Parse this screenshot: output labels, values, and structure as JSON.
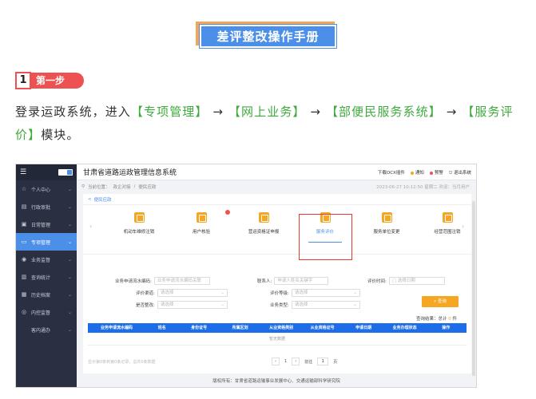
{
  "manual": {
    "title": "差评整改操作手册",
    "step_num": "1",
    "step_label": "第一步",
    "para_prefix": "登录运政系统，进入",
    "path": [
      "【专项管理】",
      "【网上业务】",
      "【部便民服务系统】",
      "【服务评价】"
    ],
    "arrow": " → ",
    "para_suffix": "模块。"
  },
  "app": {
    "sidebar": {
      "items": [
        {
          "label": "个人中心",
          "icon": "☆"
        },
        {
          "label": "行政审批",
          "icon": "▤"
        },
        {
          "label": "日常管理",
          "icon": "▣"
        },
        {
          "label": "专项管理",
          "icon": "▭"
        },
        {
          "label": "业务监督",
          "icon": "◉"
        },
        {
          "label": "查询统计",
          "icon": "▥"
        },
        {
          "label": "历史档案",
          "icon": "▦"
        },
        {
          "label": "内控监督",
          "icon": "◎"
        },
        {
          "label": "客内通办",
          "icon": ""
        }
      ]
    },
    "header": {
      "title": "甘肃省道路运政管理信息系统",
      "download": "下载OCX插件",
      "notice": "通知",
      "warning": "预警",
      "logout": "退出系统"
    },
    "breadcrumb": {
      "home": "当前位置：",
      "p1": "政企对接",
      "sep": "/",
      "p2": "便民应政",
      "info": "2023-06-27 10:12:50 星期二 欢迎：当月用户"
    },
    "panel_tab": "便民应政",
    "modules": [
      {
        "label": "机动车维修注销"
      },
      {
        "label": "用户核验"
      },
      {
        "label": "营运资格证申报"
      },
      {
        "label": "服务评价"
      },
      {
        "label": "服务单位变更"
      },
      {
        "label": "经营范围注销"
      }
    ],
    "form": {
      "f1_label": "业务申请流水编码:",
      "f1_ph": "业务申请流水编码关联",
      "f2_label": "联系人:",
      "f2_ph": "申请人姓名关键字",
      "f3_label": "评价时间:",
      "f3_ph": "选择日期",
      "f4_label": "评价渠道:",
      "f4_ph": "请选择",
      "f5_label": "评价等级:",
      "f5_ph": "请选择",
      "f6_label": "是否整改:",
      "f6_ph": "请选择",
      "f7_label": "业务类型:",
      "f7_ph": "请选择",
      "query": "查询"
    },
    "result": {
      "prefix": "查询结果：总计",
      "count": "0",
      "suffix": "件"
    },
    "table": {
      "headers": [
        "业务申请流水编码",
        "姓名",
        "身份证号",
        "所属区划",
        "从业资格类别",
        "从业资格证号",
        "申请日期",
        "业务办理状态",
        "操作"
      ],
      "empty": "暂无数据"
    },
    "pager": {
      "left": "显示第0条到第0条记录，总共0条数据",
      "prev": "‹",
      "page": "1",
      "next": "›",
      "goto": "前往",
      "goto_page": "1",
      "unit": "页"
    },
    "footer": "版权所有：甘肃省道路运输事业发展中心、交通运输部科学研究院"
  }
}
